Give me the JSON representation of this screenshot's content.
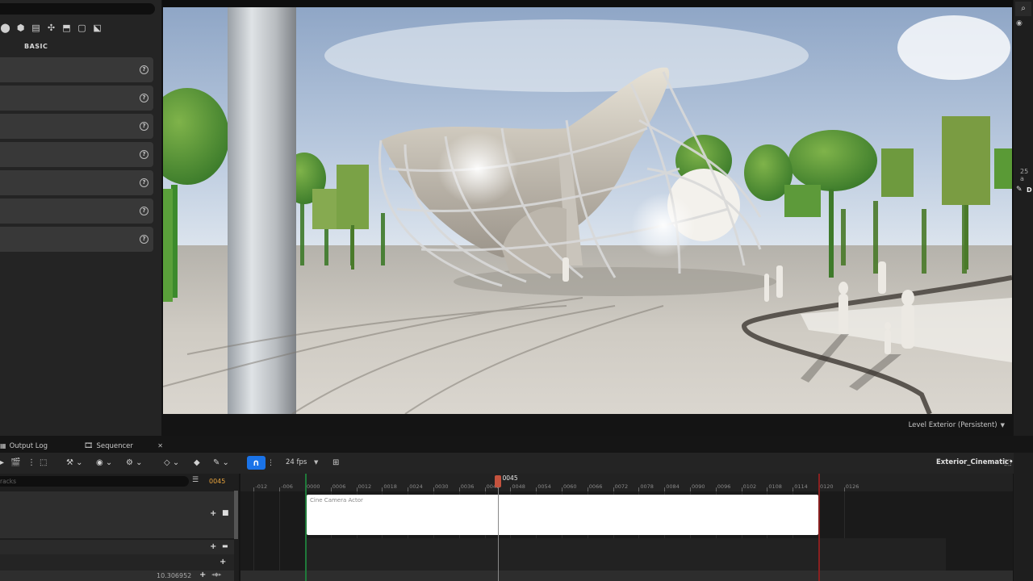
{
  "left_panel": {
    "mode_icons": [
      "place-icon",
      "shape-icon",
      "lighting-icon",
      "visual-effects-icon",
      "geometry-icon",
      "volume-icon",
      "all-classes-icon"
    ],
    "mode_glyphs": [
      "⬤",
      "⬢",
      "▤",
      "✣",
      "⬒",
      "▢",
      "⬕"
    ],
    "category_label": "BASIC",
    "rows": 7,
    "help_glyph": "?"
  },
  "viewport": {
    "level_label": "Level  Exterior (Persistent)"
  },
  "right_panel": {
    "value": "25 a",
    "letter": "D"
  },
  "bottom": {
    "tabs": [
      {
        "label": "Output Log",
        "icon": "output-log-icon"
      },
      {
        "label": "Sequencer",
        "icon": "sequencer-icon"
      }
    ],
    "fps_label": "24 fps",
    "sequence_name": "Exterior_Cinematic•",
    "track_search_placeholder": "racks",
    "current_frame": "0045",
    "value_readout": "10.306952",
    "camera_section_label": "Cine Camera Actor",
    "ruler_ticks": [
      "-012",
      "-006",
      "0000",
      "0006",
      "0012",
      "0018",
      "0024",
      "0030",
      "0036",
      "0042",
      "0048",
      "0054",
      "0060",
      "0066",
      "0072",
      "0078",
      "0084",
      "0090",
      "0096",
      "0102",
      "0108",
      "0114",
      "0120",
      "0126"
    ],
    "playhead_frame": 45,
    "range_start_frame": 0,
    "range_end_frame": 120
  }
}
